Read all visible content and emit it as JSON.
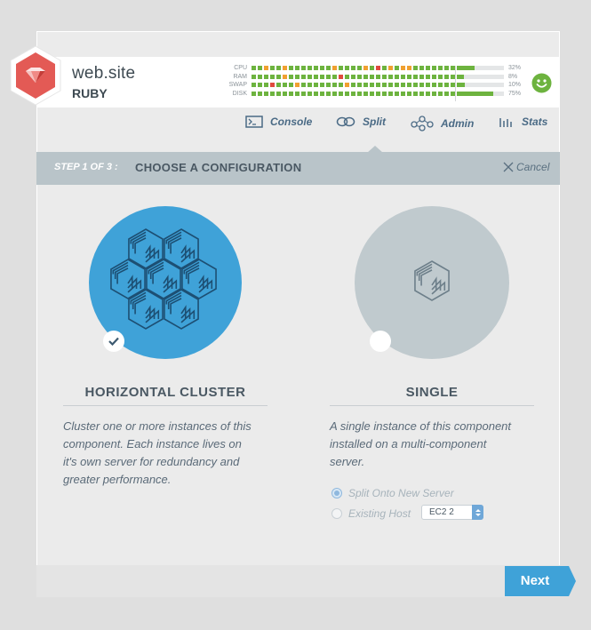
{
  "app": {
    "name": "web.site",
    "sub": "RUBY"
  },
  "metrics": [
    {
      "label": "CPU",
      "pct": "32%",
      "value": 0.32,
      "dots": [
        "#6db33f",
        "#6db33f",
        "#f0a030",
        "#6db33f",
        "#6db33f",
        "#f0a030",
        "#6db33f",
        "#6db33f",
        "#6db33f",
        "#6db33f",
        "#6db33f",
        "#6db33f",
        "#6db33f",
        "#f0a030",
        "#6db33f",
        "#6db33f",
        "#6db33f",
        "#6db33f",
        "#f0a030",
        "#6db33f",
        "#e04a3e",
        "#6db33f",
        "#f0a030",
        "#6db33f",
        "#f0a030",
        "#f0a030",
        "#6db33f",
        "#6db33f",
        "#6db33f",
        "#6db33f",
        "#6db33f",
        "#6db33f",
        "#6db33f",
        "#6db33f",
        "#6db33f",
        "#6db33f",
        "#6db33f"
      ]
    },
    {
      "label": "RAM",
      "pct": "8%",
      "value": 0.08,
      "dots": [
        "#6db33f",
        "#6db33f",
        "#6db33f",
        "#6db33f",
        "#6db33f",
        "#f0a030",
        "#6db33f",
        "#6db33f",
        "#6db33f",
        "#6db33f",
        "#6db33f",
        "#6db33f",
        "#6db33f",
        "#6db33f",
        "#e04a3e",
        "#6db33f",
        "#6db33f",
        "#6db33f",
        "#6db33f",
        "#6db33f",
        "#6db33f",
        "#6db33f",
        "#6db33f",
        "#6db33f",
        "#6db33f",
        "#6db33f",
        "#6db33f",
        "#6db33f",
        "#6db33f",
        "#6db33f",
        "#6db33f",
        "#6db33f",
        "#6db33f",
        "#6db33f",
        "#6db33f",
        "#6db33f",
        "#6db33f"
      ]
    },
    {
      "label": "SWAP",
      "pct": "10%",
      "value": 0.1,
      "dots": [
        "#6db33f",
        "#6db33f",
        "#6db33f",
        "#e04a3e",
        "#6db33f",
        "#6db33f",
        "#6db33f",
        "#f0a030",
        "#6db33f",
        "#6db33f",
        "#6db33f",
        "#6db33f",
        "#6db33f",
        "#6db33f",
        "#6db33f",
        "#f0a030",
        "#6db33f",
        "#6db33f",
        "#6db33f",
        "#6db33f",
        "#6db33f",
        "#6db33f",
        "#6db33f",
        "#6db33f",
        "#6db33f",
        "#6db33f",
        "#6db33f",
        "#6db33f",
        "#6db33f",
        "#6db33f",
        "#6db33f",
        "#6db33f",
        "#6db33f",
        "#6db33f",
        "#6db33f",
        "#6db33f",
        "#6db33f"
      ]
    },
    {
      "label": "DISK",
      "pct": "75%",
      "value": 0.75,
      "dots": [
        "#6db33f",
        "#6db33f",
        "#6db33f",
        "#6db33f",
        "#6db33f",
        "#6db33f",
        "#6db33f",
        "#6db33f",
        "#6db33f",
        "#6db33f",
        "#6db33f",
        "#6db33f",
        "#6db33f",
        "#6db33f",
        "#6db33f",
        "#6db33f",
        "#6db33f",
        "#6db33f",
        "#6db33f",
        "#6db33f",
        "#6db33f",
        "#6db33f",
        "#6db33f",
        "#6db33f",
        "#6db33f",
        "#6db33f",
        "#6db33f",
        "#6db33f",
        "#6db33f",
        "#6db33f",
        "#6db33f",
        "#6db33f",
        "#6db33f",
        "#6db33f",
        "#6db33f",
        "#6db33f",
        "#6db33f"
      ]
    }
  ],
  "nav": {
    "console": "Console",
    "split": "Split",
    "admin": "Admin",
    "stats": "Stats"
  },
  "step": {
    "number": "STEP 1 OF 3 :",
    "title": "CHOOSE A CONFIGURATION",
    "cancel": "Cancel"
  },
  "options": {
    "cluster": {
      "title": "HORIZONTAL CLUSTER",
      "desc": [
        "Cluster one or more instances of this",
        "component. Each instance lives on",
        "it's own server for redundancy and",
        "greater performance."
      ],
      "selected": true
    },
    "single": {
      "title": "SINGLE",
      "desc": [
        "A single instance of this component",
        "installed on a multi-component",
        "server."
      ],
      "selected": false,
      "radio_split": "Split Onto New Server",
      "radio_existing": "Existing Host",
      "host_value": "EC2 2"
    }
  },
  "footer": {
    "next": "Next"
  },
  "colors": {
    "accent": "#3fa2d8",
    "grey_circle": "#c0cace",
    "logo": "#e35a55",
    "ok": "#6db33f",
    "warn": "#f0a030",
    "err": "#e04a3e"
  }
}
